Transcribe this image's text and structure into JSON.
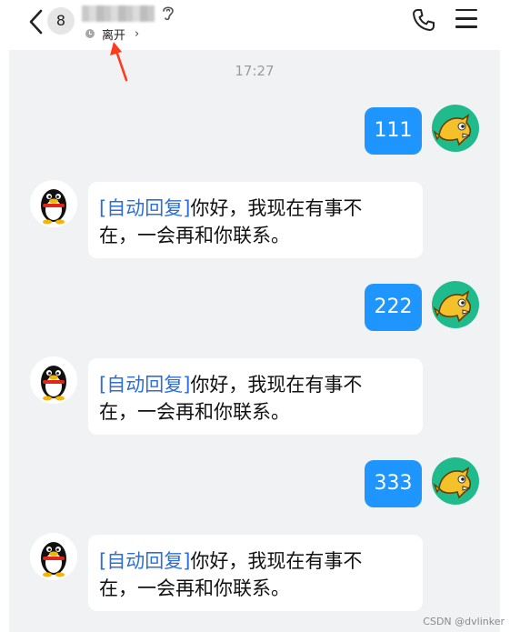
{
  "header": {
    "unread_count": "8",
    "status": "离开",
    "status_chevron": "›",
    "icons": {
      "back": "back-arrow-icon",
      "ear": "ear-icon",
      "clock": "clock-icon",
      "phone": "phone-icon",
      "menu": "menu-icon"
    },
    "annotation_color": "#ff3b1f"
  },
  "chat": {
    "timestamp": "17:27",
    "messages": [
      {
        "direction": "sent",
        "text": "111"
      },
      {
        "direction": "received",
        "tag": "[自动回复]",
        "body_line1": "你好，我现在有事不",
        "body_line2": "在，一会再和你联系。"
      },
      {
        "direction": "sent",
        "text": "222"
      },
      {
        "direction": "received",
        "tag": "[自动回复]",
        "body_line1": "你好，我现在有事不",
        "body_line2": "在，一会再和你联系。"
      },
      {
        "direction": "sent",
        "text": "333"
      },
      {
        "direction": "received",
        "tag": "[自动回复]",
        "body_line1": "你好，我现在有事不",
        "body_line2": "在，一会再和你联系。"
      }
    ]
  },
  "colors": {
    "sent_bubble": "#1f95ff",
    "chat_background": "#f1f2f4",
    "auto_reply_tag": "#2d6fd6"
  },
  "watermark": "CSDN @dvlinker"
}
